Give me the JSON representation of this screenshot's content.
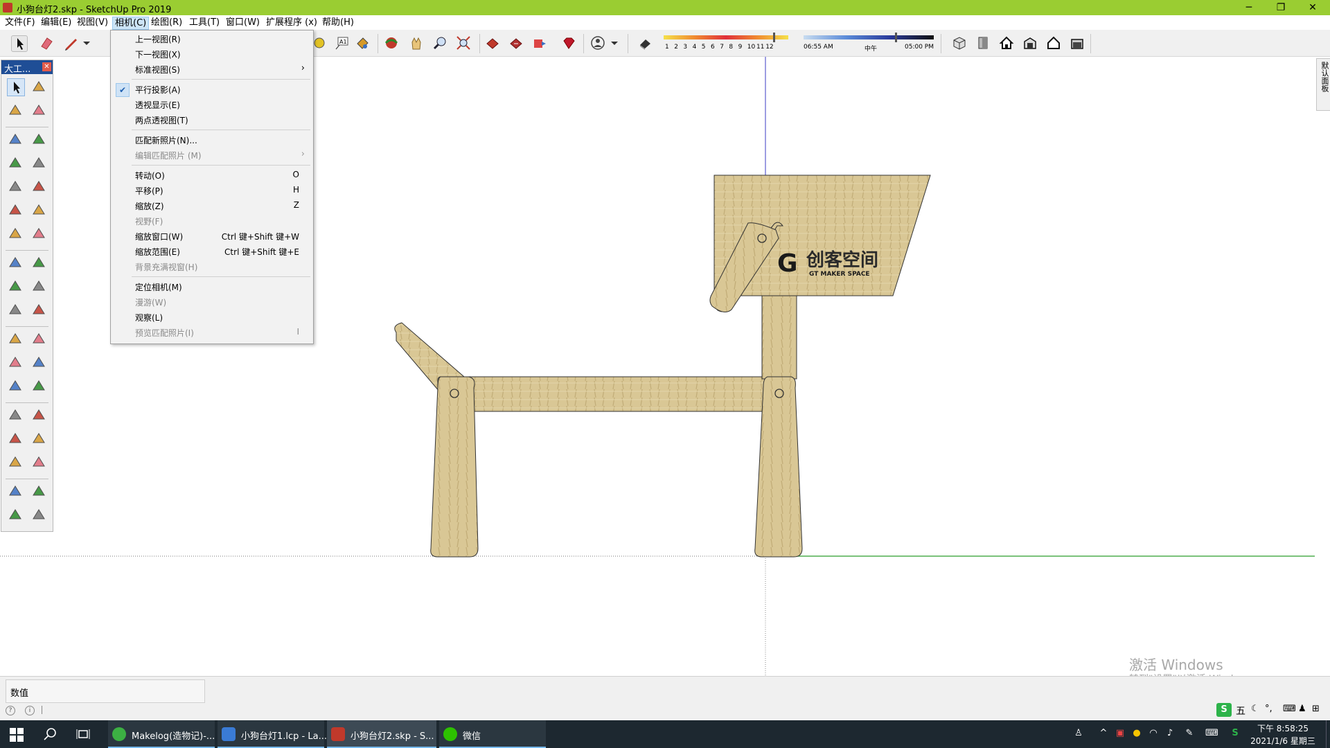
{
  "window": {
    "title": "小狗台灯2.skp - SketchUp Pro 2019",
    "controls": [
      "─",
      "❐",
      "✕"
    ]
  },
  "menubar": [
    "文件(F)",
    "编辑(E)",
    "视图(V)",
    "相机(C)",
    "绘图(R)",
    "工具(T)",
    "窗口(W)",
    "扩展程序 (x)",
    "帮助(H)"
  ],
  "camera_menu": {
    "items": [
      {
        "label": "上一视图(R)",
        "shortcut": "",
        "disabled": false
      },
      {
        "label": "下一视图(X)",
        "shortcut": "",
        "disabled": false
      },
      {
        "label": "标准视图(S)",
        "shortcut": "",
        "disabled": false,
        "submenu": true
      },
      {
        "label": "平行投影(A)",
        "shortcut": "",
        "disabled": false,
        "checked": true
      },
      {
        "label": "透视显示(E)",
        "shortcut": "",
        "disabled": false
      },
      {
        "label": "两点透视图(T)",
        "shortcut": "",
        "disabled": false
      },
      {
        "label": "匹配新照片(N)...",
        "shortcut": "",
        "disabled": false
      },
      {
        "label": "编辑匹配照片 (M)",
        "shortcut": "",
        "disabled": true,
        "submenu": true
      },
      {
        "label": "转动(O)",
        "shortcut": "O",
        "disabled": false
      },
      {
        "label": "平移(P)",
        "shortcut": "H",
        "disabled": false
      },
      {
        "label": "缩放(Z)",
        "shortcut": "Z",
        "disabled": false
      },
      {
        "label": "视野(F)",
        "shortcut": "",
        "disabled": true
      },
      {
        "label": "缩放窗口(W)",
        "shortcut": "Ctrl 键+Shift 键+W",
        "disabled": false
      },
      {
        "label": "缩放范围(E)",
        "shortcut": "Ctrl 键+Shift 键+E",
        "disabled": false
      },
      {
        "label": "背景充满视窗(H)",
        "shortcut": "",
        "disabled": true
      },
      {
        "label": "定位相机(M)",
        "shortcut": "",
        "disabled": false
      },
      {
        "label": "漫游(W)",
        "shortcut": "",
        "disabled": true
      },
      {
        "label": "观察(L)",
        "shortcut": "",
        "disabled": false
      },
      {
        "label": "预览匹配照片(I)",
        "shortcut": "I",
        "disabled": true
      }
    ]
  },
  "shadow_bar": {
    "months": [
      "1",
      "2",
      "3",
      "4",
      "5",
      "6",
      "7",
      "8",
      "9",
      "10",
      "11",
      "12"
    ],
    "time_start": "06:55 AM",
    "time_mid": "中午",
    "time_end": "05:00 PM"
  },
  "palette": {
    "title": "大工..."
  },
  "model": {
    "logo_text": "创客空间",
    "logo_sub": "GT MAKER SPACE",
    "logo_mark": "G"
  },
  "tray": {
    "tab_label": "默认面板"
  },
  "watermark": {
    "line1": "激活 Windows",
    "line2": "转到\"设置\"以激活 Windows。"
  },
  "status": {
    "measurements_label": "数值"
  },
  "taskbar": {
    "apps": [
      {
        "label": "Makelog(造物记)-...",
        "color": "#3cb043"
      },
      {
        "label": "小狗台灯1.lcp - La...",
        "color": "#3a7bd5"
      },
      {
        "label": "小狗台灯2.skp - S...",
        "color": "#c0392b"
      },
      {
        "label": "微信",
        "color": "#2dc100"
      }
    ],
    "clock_time": "下午 8:58:25",
    "clock_date": "2021/1/6 星期三",
    "ime": "五"
  },
  "colors": {
    "titlebar": "#9ACD32",
    "wood": "#d8c594",
    "axis_blue": "#3030c0",
    "axis_green": "#2a9d2a"
  }
}
